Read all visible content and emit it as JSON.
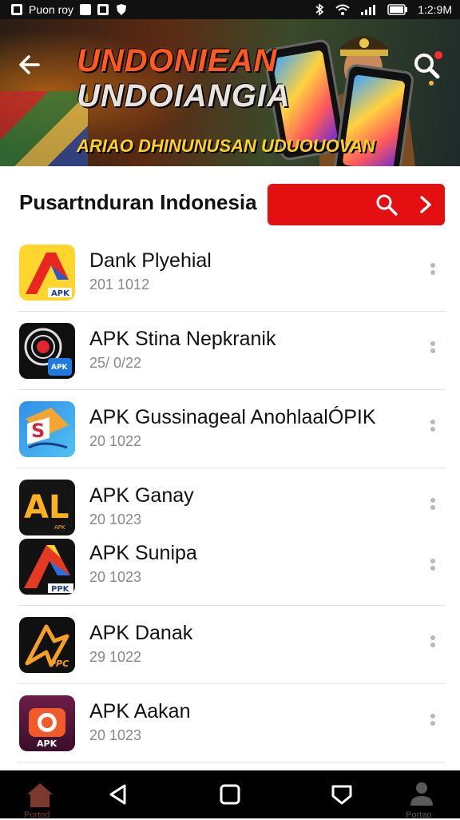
{
  "status_bar": {
    "carrier": "Puon roy",
    "time": "1:2:9M"
  },
  "hero": {
    "title_line1": "UNDONIEAN",
    "title_line2": "UNDOIANGIA",
    "subtitle": "ARIAO DHINUNUSAN UDUOUOVAN"
  },
  "header": {
    "title": "Pusartnduran Indonesia"
  },
  "apps": [
    {
      "name": "Dank Plyehial",
      "date": "201 1012",
      "icon": "apk-icon-a"
    },
    {
      "name": "APK Stina Nepkranik",
      "date": "25/ 0/22",
      "icon": "apk-icon-dark-circle"
    },
    {
      "name": "APK Gussinageal AnohlaalÓPIK",
      "date": "20 1022",
      "icon": "apk-icon-s"
    },
    {
      "name": "APK Ganay",
      "date": "20 1023",
      "icon": "apk-icon-al"
    },
    {
      "name": "APK Sunipa",
      "date": "20 1023",
      "icon": "apk-icon-triangle"
    },
    {
      "name": "APK Danak",
      "date": "29 1022",
      "icon": "apk-icon-spark"
    },
    {
      "name": "APK Aakan",
      "date": "20 1023",
      "icon": "apk-icon-camera"
    }
  ],
  "nav": {
    "home_label": "Portod",
    "profile_label": "Portao"
  },
  "colors": {
    "accent_red": "#e30f11",
    "nav_bg": "#000000",
    "status_bg": "#111111"
  }
}
